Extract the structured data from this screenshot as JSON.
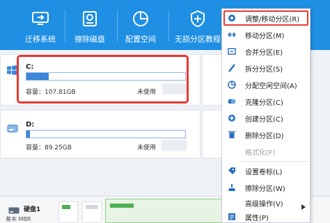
{
  "toolbar": {
    "items": [
      {
        "label": "迁移系统",
        "icon": "migrate-system-icon"
      },
      {
        "label": "擦除磁盘",
        "icon": "wipe-disk-icon"
      },
      {
        "label": "配置空间",
        "icon": "allocate-space-icon"
      },
      {
        "label": "无损分区教程",
        "icon": "shield-icon"
      }
    ]
  },
  "partitions": [
    {
      "name": "C:",
      "capacity": "容量：107.81GB",
      "unused": "未使用",
      "used_fraction": 0.14
    },
    {
      "name": "D:",
      "capacity": "容量：89.25GB",
      "unused": "未使用",
      "used_fraction": 0.02
    }
  ],
  "disk": {
    "name": "硬盘1",
    "type": "基本 MBR"
  },
  "context_menu": {
    "items": [
      {
        "label": "调整/移动分区(R)",
        "icon": "resize-partition-icon",
        "enabled": true
      },
      {
        "label": "移动分区(M)",
        "icon": "move-partition-icon",
        "enabled": true
      },
      {
        "label": "合并分区(E)",
        "icon": "merge-partition-icon",
        "enabled": true
      },
      {
        "label": "拆分分区(S)",
        "icon": "split-partition-icon",
        "enabled": true
      },
      {
        "label": "分配空闲空间(A)",
        "icon": "allocate-free-space-icon",
        "enabled": true
      },
      {
        "label": "克隆分区(C)",
        "icon": "clone-partition-icon",
        "enabled": true
      },
      {
        "label": "创建分区(C)",
        "icon": "create-partition-icon",
        "enabled": true
      },
      {
        "label": "删除分区(D)",
        "icon": "delete-partition-icon",
        "enabled": true
      },
      {
        "label": "格式化(F)",
        "icon": "",
        "enabled": false
      },
      {
        "label": "设置卷标(L)",
        "icon": "set-label-icon",
        "enabled": true
      },
      {
        "label": "擦除分区(W)",
        "icon": "wipe-partition-icon",
        "enabled": true
      },
      {
        "label": "高级操作(V)",
        "icon": "",
        "enabled": true,
        "submenu": true
      },
      {
        "label": "属性(P)",
        "icon": "properties-icon",
        "enabled": true
      }
    ]
  },
  "colors": {
    "toolbar": "#1e8fe3",
    "highlight": "#e8382f",
    "bar_fill": "#3b86d6",
    "disk_used": "#4caf50"
  }
}
